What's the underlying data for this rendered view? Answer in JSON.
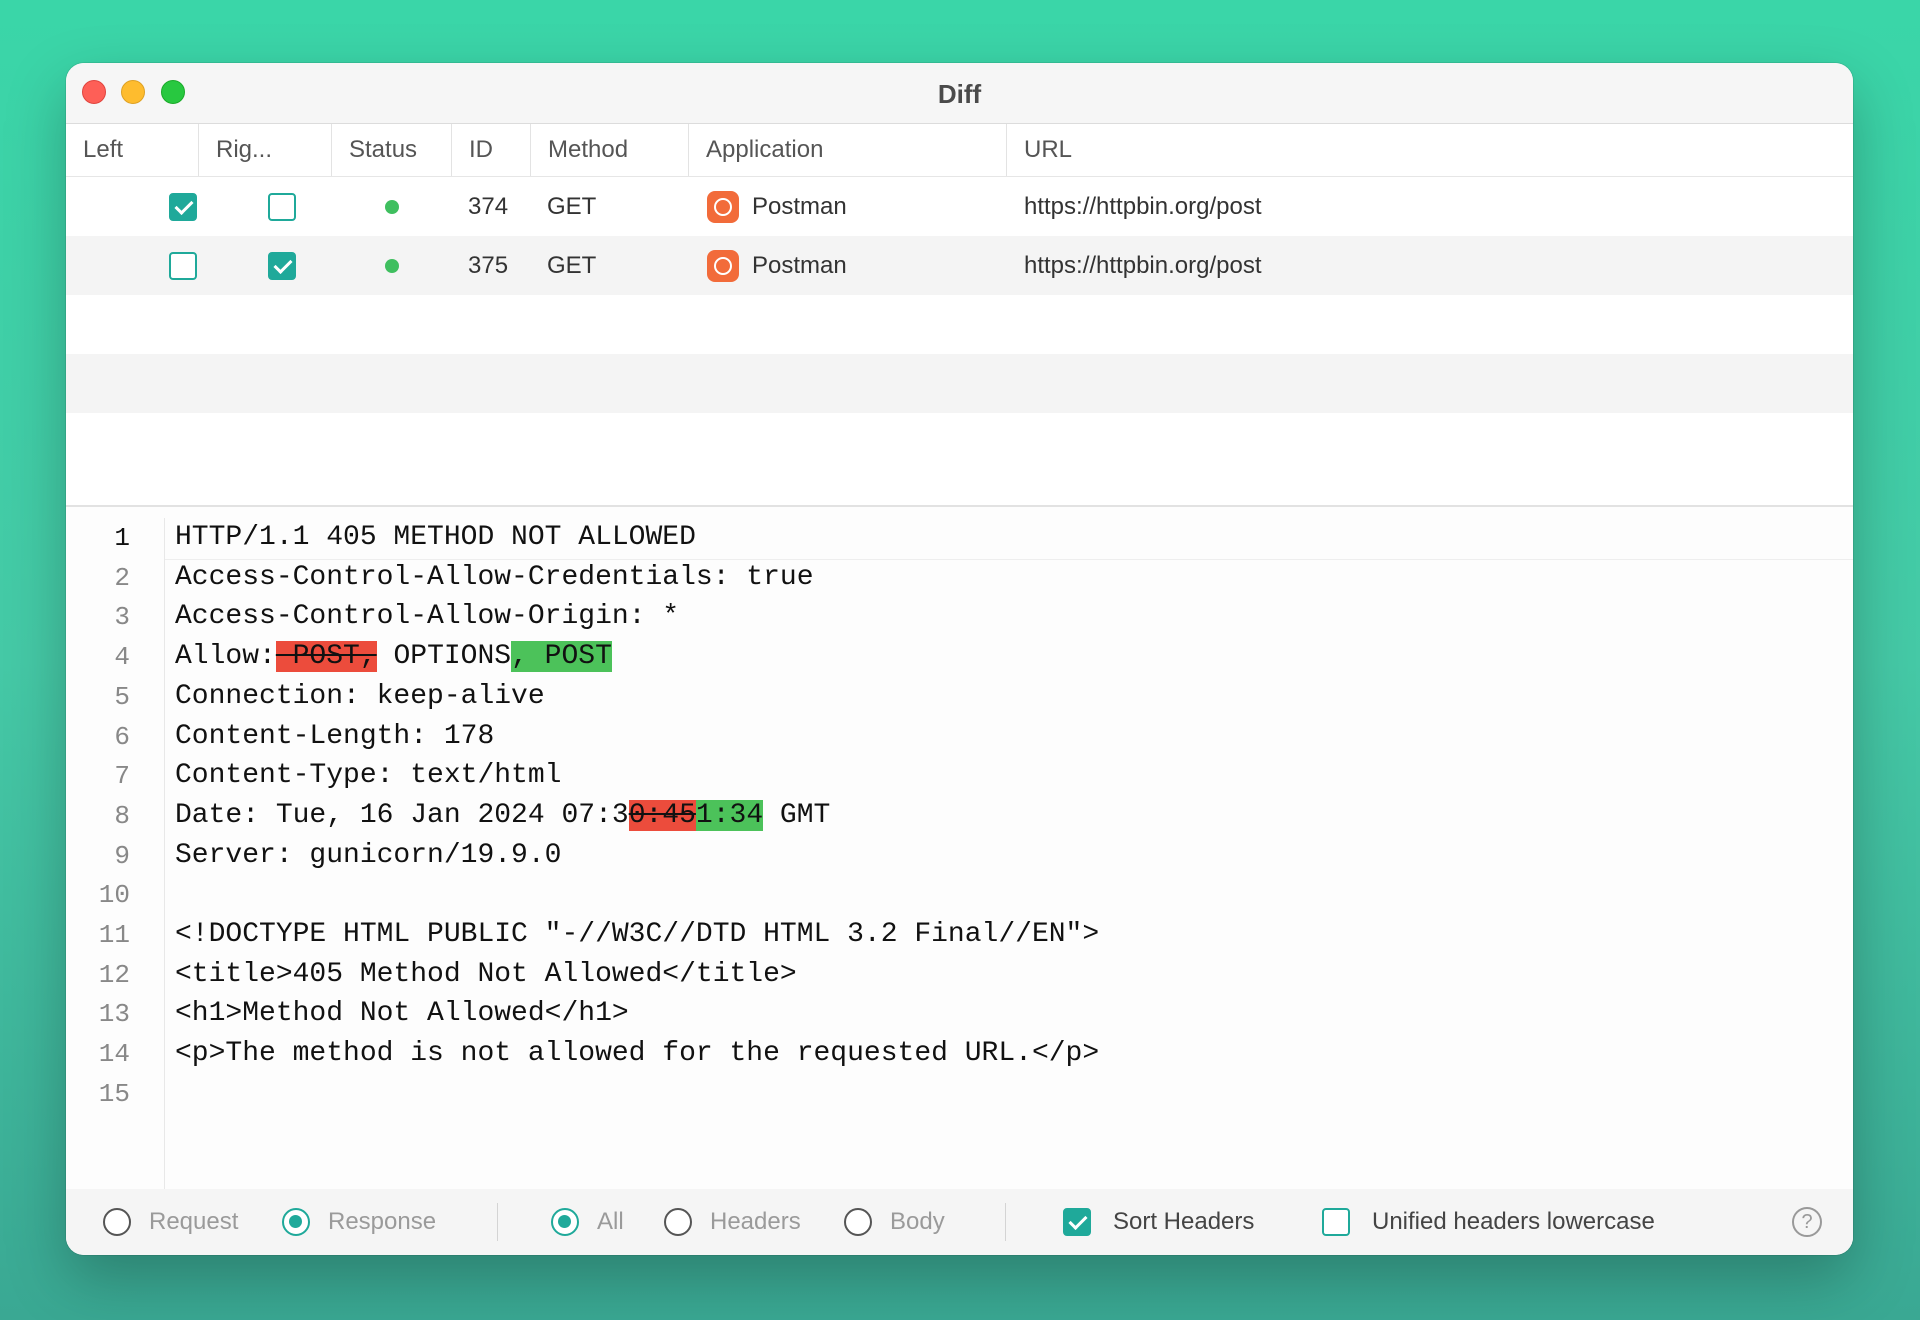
{
  "window": {
    "title": "Diff"
  },
  "table": {
    "columns": [
      "Left",
      "Rig...",
      "Status",
      "ID",
      "Method",
      "Application",
      "URL"
    ],
    "rows": [
      {
        "left": true,
        "right": false,
        "status": "success",
        "id": "374",
        "method": "GET",
        "app": "Postman",
        "url": "https://httpbin.org/post"
      },
      {
        "left": false,
        "right": true,
        "status": "success",
        "id": "375",
        "method": "GET",
        "app": "Postman",
        "url": "https://httpbin.org/post"
      }
    ]
  },
  "diff": {
    "lines": [
      {
        "num": "1",
        "parts": [
          {
            "t": "HTTP/1.1 405 METHOD NOT ALLOWED",
            "k": "normal"
          }
        ]
      },
      {
        "num": "2",
        "parts": [
          {
            "t": "Access-Control-Allow-Credentials: true",
            "k": "normal"
          }
        ]
      },
      {
        "num": "3",
        "parts": [
          {
            "t": "Access-Control-Allow-Origin: *",
            "k": "normal"
          }
        ]
      },
      {
        "num": "4",
        "parts": [
          {
            "t": "Allow:",
            "k": "normal"
          },
          {
            "t": " POST,",
            "k": "del"
          },
          {
            "t": " OPTIONS",
            "k": "normal"
          },
          {
            "t": ", POST",
            "k": "ins"
          }
        ]
      },
      {
        "num": "5",
        "parts": [
          {
            "t": "Connection: keep-alive",
            "k": "normal"
          }
        ]
      },
      {
        "num": "6",
        "parts": [
          {
            "t": "Content-Length: 178",
            "k": "normal"
          }
        ]
      },
      {
        "num": "7",
        "parts": [
          {
            "t": "Content-Type: text/html",
            "k": "normal"
          }
        ]
      },
      {
        "num": "8",
        "parts": [
          {
            "t": "Date: Tue, 16 Jan 2024 07:3",
            "k": "normal"
          },
          {
            "t": "0:45",
            "k": "del"
          },
          {
            "t": "1:34",
            "k": "ins"
          },
          {
            "t": " GMT",
            "k": "normal"
          }
        ]
      },
      {
        "num": "9",
        "parts": [
          {
            "t": "Server: gunicorn/19.9.0",
            "k": "normal"
          }
        ]
      },
      {
        "num": "10",
        "parts": []
      },
      {
        "num": "11",
        "parts": [
          {
            "t": "<!DOCTYPE HTML PUBLIC \"-//W3C//DTD HTML 3.2 Final//EN\">",
            "k": "normal"
          }
        ]
      },
      {
        "num": "12",
        "parts": [
          {
            "t": "<title>405 Method Not Allowed</title>",
            "k": "normal"
          }
        ]
      },
      {
        "num": "13",
        "parts": [
          {
            "t": "<h1>Method Not Allowed</h1>",
            "k": "normal"
          }
        ]
      },
      {
        "num": "14",
        "parts": [
          {
            "t": "<p>The method is not allowed for the requested URL.</p>",
            "k": "normal"
          }
        ]
      },
      {
        "num": "15",
        "parts": []
      }
    ]
  },
  "footer": {
    "request_label": "Request",
    "response_label": "Response",
    "all_label": "All",
    "headers_label": "Headers",
    "body_label": "Body",
    "sort_headers_label": "Sort Headers",
    "sort_headers_checked": true,
    "unified_lowercase_label": "Unified headers lowercase",
    "unified_lowercase_checked": false,
    "help_label": "?"
  },
  "colors": {
    "accent": "#1fa99a",
    "deleted": "#ec4c3c",
    "inserted": "#4cc25a",
    "status_ok": "#3fbf5f",
    "app_icon": "#f26b3a"
  }
}
